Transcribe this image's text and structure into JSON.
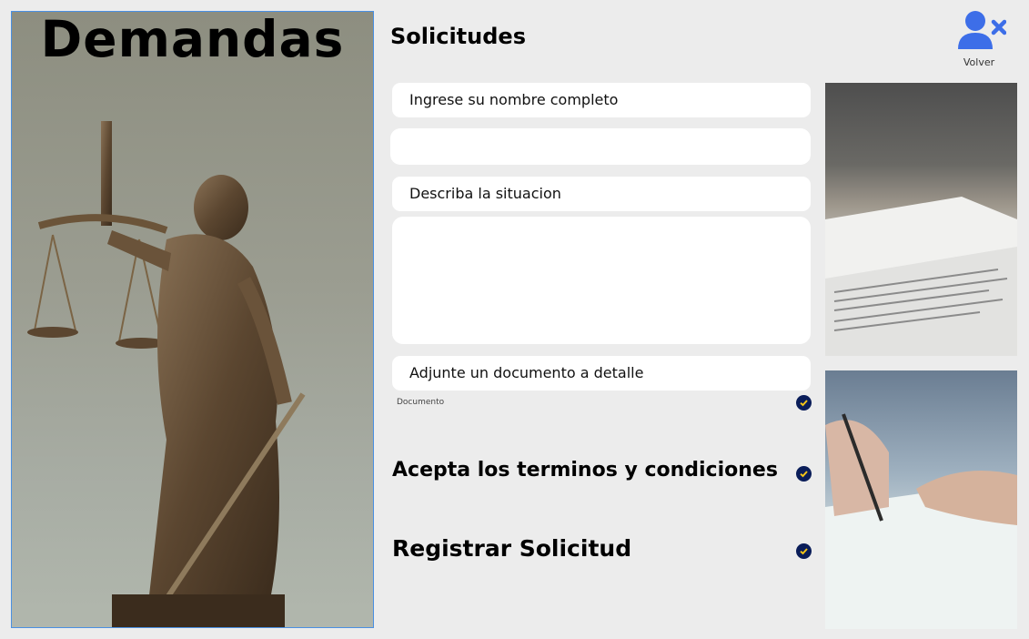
{
  "hero": {
    "title": "Demandas",
    "image": "lady-justice-statue"
  },
  "form": {
    "title": "Solicitudes",
    "name_label": "Ingrese su nombre completo",
    "name_value": "",
    "situation_label": "Describa la situacion",
    "situation_value": "",
    "document_label": "Adjunte un documento a detalle",
    "document_caption": "Documento",
    "terms_text": "Acepta los terminos y condiciones",
    "register_text": "Registrar Solicitud",
    "check_icon": "check-circle-icon"
  },
  "header": {
    "back_label": "Volver",
    "back_icon": "user-remove-icon"
  },
  "photos": [
    "documents-photo",
    "signing-photo"
  ],
  "colors": {
    "accent_blue": "#3d6ee8",
    "check_navy": "#0a1d59",
    "background": "#ececec"
  }
}
